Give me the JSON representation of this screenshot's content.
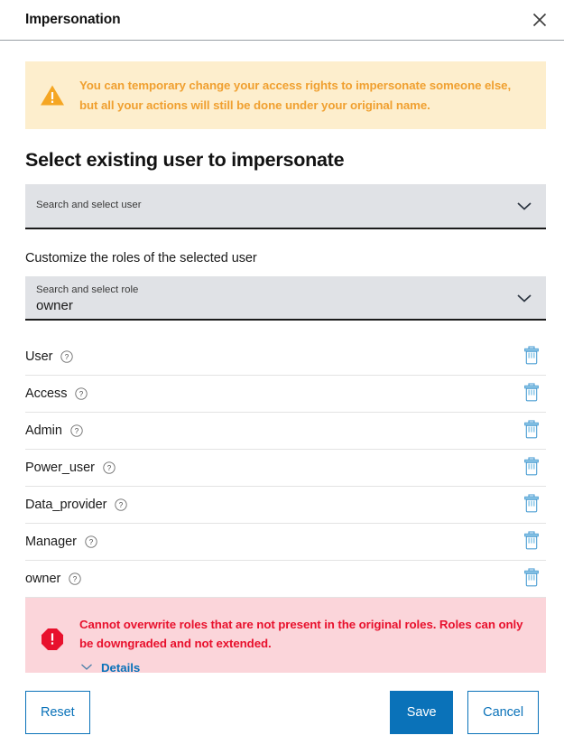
{
  "dialog": {
    "title": "Impersonation",
    "close_icon": "close-icon"
  },
  "warning": {
    "icon": "warning-triangle-icon",
    "text": "You can temporary change your access rights to impersonate someone else, but all your actions will still be done under your original name.",
    "background_color": "#fdeecd",
    "text_color": "#f0a030"
  },
  "user_section": {
    "heading": "Select existing user to impersonate",
    "select": {
      "label": "Search and select user",
      "value": "",
      "chevron_icon": "chevron-down-icon"
    }
  },
  "roles_section": {
    "heading": "Customize the roles of the selected user",
    "select": {
      "label": "Search and select role",
      "value": "owner",
      "chevron_icon": "chevron-down-icon"
    },
    "roles": [
      {
        "name": "User",
        "help_icon": "help-circle-icon",
        "delete_icon": "trash-icon"
      },
      {
        "name": "Access",
        "help_icon": "help-circle-icon",
        "delete_icon": "trash-icon"
      },
      {
        "name": "Admin",
        "help_icon": "help-circle-icon",
        "delete_icon": "trash-icon"
      },
      {
        "name": "Power_user",
        "help_icon": "help-circle-icon",
        "delete_icon": "trash-icon"
      },
      {
        "name": "Data_provider",
        "help_icon": "help-circle-icon",
        "delete_icon": "trash-icon"
      },
      {
        "name": "Manager",
        "help_icon": "help-circle-icon",
        "delete_icon": "trash-icon"
      },
      {
        "name": "owner",
        "help_icon": "help-circle-icon",
        "delete_icon": "trash-icon"
      }
    ]
  },
  "error": {
    "icon": "error-octagon-icon",
    "text": "Cannot overwrite roles that are not present in the original roles. Roles can only be downgraded and not extended.",
    "details_label": "Details",
    "details_icon": "chevron-down-icon",
    "background_color": "#fbd5da",
    "text_color": "#e8112d",
    "link_color": "#0a72b9"
  },
  "footer": {
    "reset_label": "Reset",
    "save_label": "Save",
    "cancel_label": "Cancel",
    "primary_color": "#0a72b9"
  }
}
